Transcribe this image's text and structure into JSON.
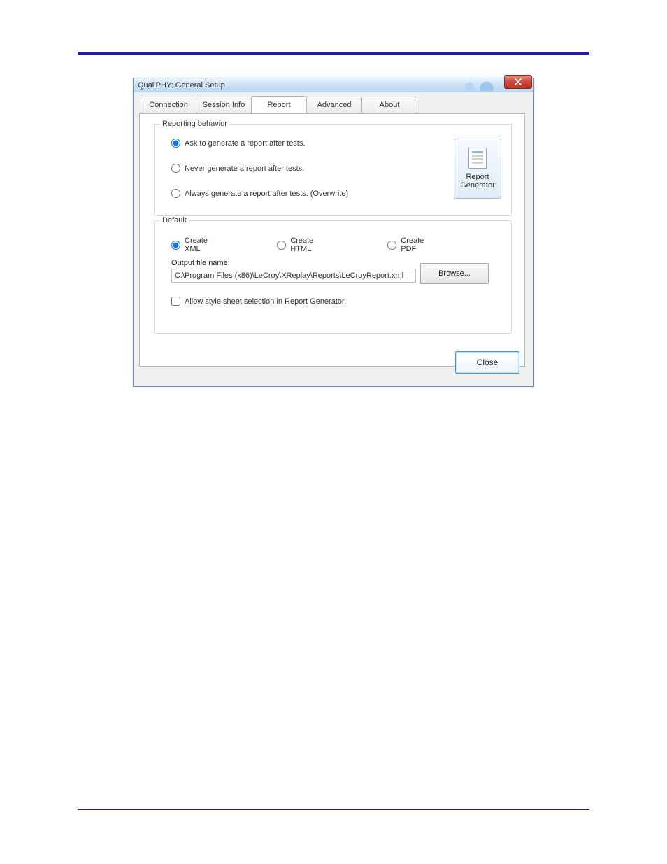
{
  "window": {
    "title": "QualiPHY: General Setup"
  },
  "tabs": {
    "connection": "Connection",
    "session_info": "Session Info",
    "report": "Report",
    "advanced": "Advanced",
    "about": "About",
    "active": "report"
  },
  "behavior": {
    "legend": "Reporting behavior",
    "ask": "Ask to generate a report after tests.",
    "never": "Never generate a report after tests.",
    "always": "Always generate a report after tests. (Overwrite)",
    "selected": "ask"
  },
  "report_generator": {
    "line1": "Report",
    "line2": "Generator"
  },
  "default": {
    "legend": "Default",
    "create_xml": "Create XML",
    "create_html": "Create HTML",
    "create_pdf": "Create PDF",
    "format_selected": "xml",
    "output_label": "Output file name:",
    "output_value": "C:\\Program Files (x86)\\LeCroy\\XReplay\\Reports\\LeCroyReport.xml",
    "browse": "Browse...",
    "allow_style": "Allow style sheet selection in Report Generator.",
    "allow_style_checked": false
  },
  "buttons": {
    "close": "Close"
  }
}
